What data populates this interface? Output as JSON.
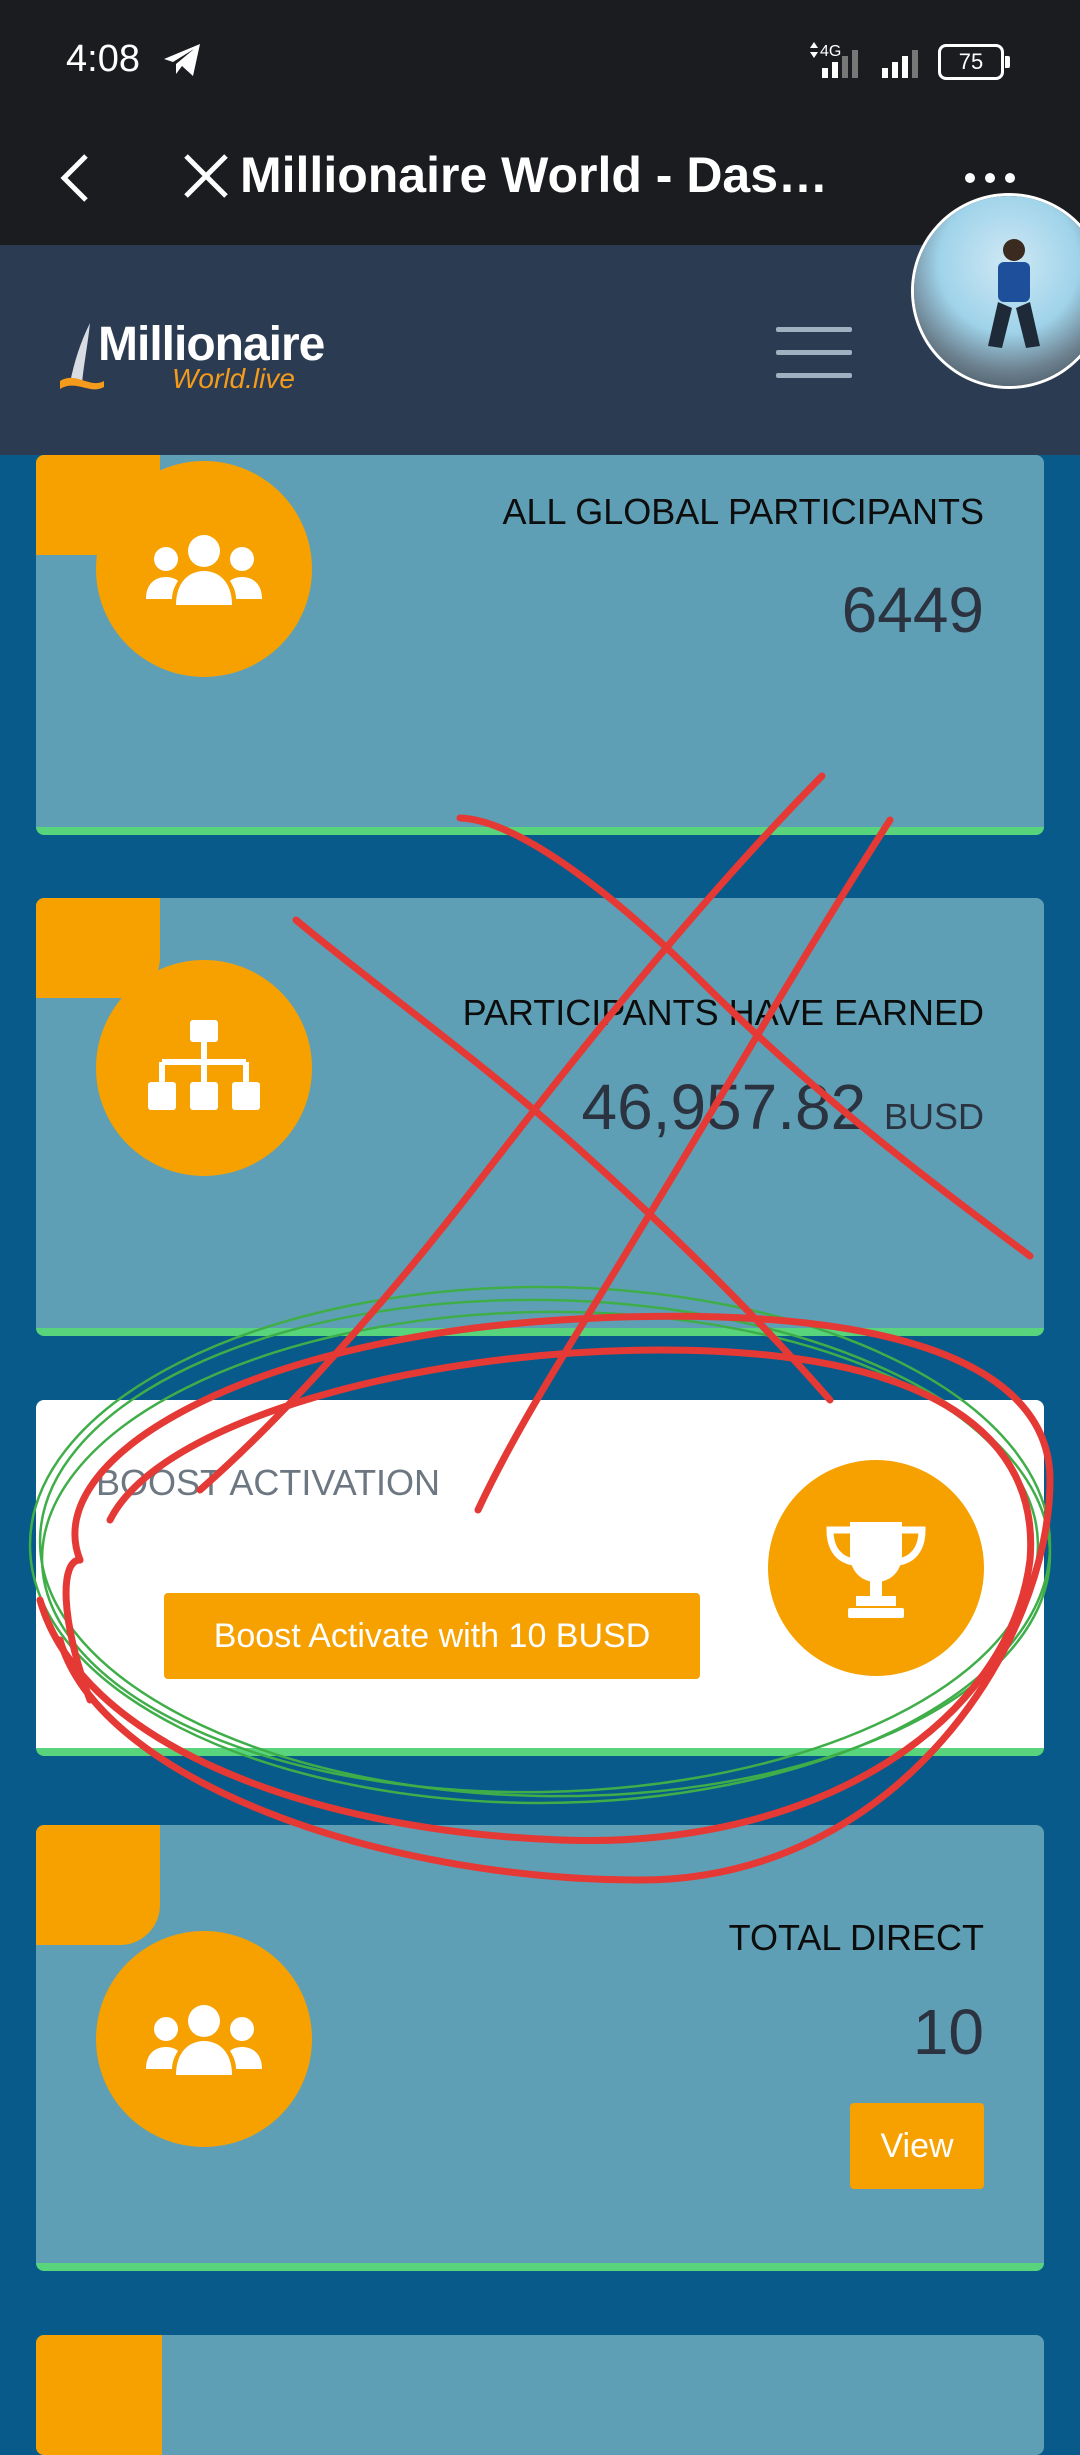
{
  "status_bar": {
    "time": "4:08",
    "network": "4G",
    "battery": "75"
  },
  "app_bar": {
    "title": "Millionaire World - Dash…"
  },
  "header": {
    "logo_line1": "Millionaire",
    "logo_line2": "World.live"
  },
  "cards": [
    {
      "label": "ALL GLOBAL PARTICIPANTS",
      "value": "6449",
      "icon": "users-icon"
    },
    {
      "label": "PARTICIPANTS HAVE EARNED",
      "value": "46,957.82",
      "unit": "BUSD",
      "icon": "sitemap-icon"
    },
    {
      "label": "BOOST ACTIVATION",
      "button": "Boost Activate with 10 BUSD",
      "icon": "trophy-icon"
    },
    {
      "label": "TOTAL DIRECT",
      "value": "10",
      "button": "View",
      "icon": "users-icon"
    }
  ],
  "colors": {
    "accent": "#f6a100",
    "card": "#5f9fb5",
    "background": "#075a8a",
    "header": "#2b3b51",
    "border": "#58d47d",
    "annotation_red": "#e53935",
    "annotation_green": "#3fae49"
  }
}
